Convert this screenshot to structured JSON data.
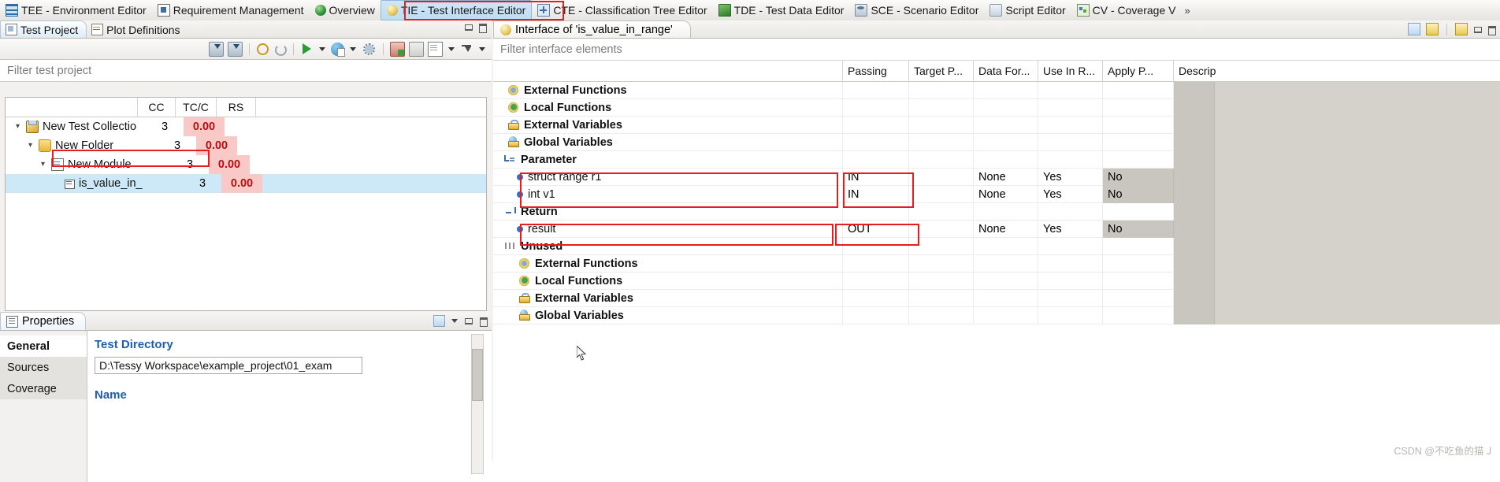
{
  "perspectives": [
    {
      "label": "TEE - Environment Editor",
      "icon": "grid-icon",
      "active": false
    },
    {
      "label": "Requirement Management",
      "icon": "document-icon",
      "active": false
    },
    {
      "label": "Overview",
      "icon": "globe-icon",
      "active": false
    },
    {
      "label": "TIE - Test Interface Editor",
      "icon": "tie-icon",
      "active": true
    },
    {
      "label": "CTE - Classification Tree Editor",
      "icon": "cte-icon",
      "active": false
    },
    {
      "label": "TDE - Test Data Editor",
      "icon": "tde-icon",
      "active": false
    },
    {
      "label": "SCE - Scenario Editor",
      "icon": "sce-icon",
      "active": false
    },
    {
      "label": "Script Editor",
      "icon": "script-icon",
      "active": false
    },
    {
      "label": "CV - Coverage V",
      "icon": "coverage-icon",
      "active": false
    }
  ],
  "topbar_overflow": "»",
  "left": {
    "tabs": [
      {
        "label": "Test Project",
        "icon": "test-project-icon",
        "selected": true
      },
      {
        "label": "Plot Definitions",
        "icon": "plot-definitions-icon",
        "selected": false
      }
    ],
    "filter_placeholder": "Filter test project",
    "toolbar_icons": [
      "import-icon",
      "export-icon",
      "separator",
      "find-icon",
      "refresh-icon",
      "separator",
      "run-icon",
      "run-dropdown-caret",
      "run-report-icon",
      "report-dropdown-caret",
      "settings-icon",
      "separator",
      "new-test-icon",
      "copy-icon",
      "paste-icon",
      "page-dropdown-caret",
      "filter-icon",
      "filter-dropdown-caret"
    ],
    "columns": [
      "",
      "CC",
      "TC/C",
      "RS"
    ],
    "rows": [
      {
        "name": "New Test Collectio",
        "icon": "collection-icon",
        "indent": 0,
        "expanded": true,
        "cc": "3",
        "tcc": "0.00",
        "selected": false
      },
      {
        "name": "New Folder",
        "icon": "folder-icon",
        "indent": 1,
        "expanded": true,
        "cc": "3",
        "tcc": "0.00",
        "selected": false
      },
      {
        "name": "New Module",
        "icon": "module-icon",
        "indent": 2,
        "expanded": true,
        "cc": "3",
        "tcc": "0.00",
        "selected": false
      },
      {
        "name": "is_value_in_",
        "icon": "function-icon",
        "indent": 3,
        "expanded": false,
        "cc": "3",
        "tcc": "0.00",
        "selected": true
      }
    ]
  },
  "properties": {
    "tab_label": "Properties",
    "nav": [
      "General",
      "Sources",
      "Coverage"
    ],
    "test_directory_label": "Test Directory",
    "test_directory_value": "D:\\Tessy Workspace\\example_project\\01_exam",
    "name_label": "Name"
  },
  "editor": {
    "tab_label": "Interface of 'is_value_in_range'",
    "tab_icon": "tie-icon",
    "filter_placeholder": "Filter interface elements",
    "columns": [
      "",
      "Passing",
      "Target P...",
      "Data For...",
      "Use In R...",
      "Apply P...",
      "Descrip"
    ],
    "rows": [
      {
        "name": "External Functions",
        "icon": "external-functions-icon",
        "indent": 1,
        "type": "group",
        "passing": "",
        "target": "",
        "dataformat": "",
        "useinr": "",
        "applyp": ""
      },
      {
        "name": "Local Functions",
        "icon": "local-functions-icon",
        "indent": 1,
        "type": "group",
        "passing": "",
        "target": "",
        "dataformat": "",
        "useinr": "",
        "applyp": ""
      },
      {
        "name": "External Variables",
        "icon": "external-variables-icon",
        "indent": 1,
        "type": "group",
        "passing": "",
        "target": "",
        "dataformat": "",
        "useinr": "",
        "applyp": ""
      },
      {
        "name": "Global Variables",
        "icon": "global-variables-icon",
        "indent": 1,
        "type": "group",
        "passing": "",
        "target": "",
        "dataformat": "",
        "useinr": "",
        "applyp": ""
      },
      {
        "name": "Parameter",
        "icon": "parameter-icon",
        "indent": 1,
        "type": "group",
        "passing": "",
        "target": "",
        "dataformat": "",
        "useinr": "",
        "applyp": ""
      },
      {
        "name": "struct range r1",
        "icon": "bullet-icon",
        "indent": 2,
        "type": "leaf",
        "passing": "IN",
        "target": "",
        "dataformat": "None",
        "useinr": "Yes",
        "applyp": "No"
      },
      {
        "name": "int v1",
        "icon": "bullet-icon",
        "indent": 2,
        "type": "leaf",
        "passing": "IN",
        "target": "",
        "dataformat": "None",
        "useinr": "Yes",
        "applyp": "No"
      },
      {
        "name": "Return",
        "icon": "return-icon",
        "indent": 1,
        "type": "group",
        "passing": "",
        "target": "",
        "dataformat": "",
        "useinr": "",
        "applyp": ""
      },
      {
        "name": "result",
        "icon": "bullet-icon",
        "indent": 2,
        "type": "leaf",
        "passing": "OUT",
        "target": "",
        "dataformat": "None",
        "useinr": "Yes",
        "applyp": "No"
      },
      {
        "name": "Unused",
        "icon": "unused-icon",
        "indent": 1,
        "type": "group",
        "passing": "",
        "target": "",
        "dataformat": "",
        "useinr": "",
        "applyp": ""
      },
      {
        "name": "External Functions",
        "icon": "external-functions-icon",
        "indent": 2,
        "type": "group",
        "passing": "",
        "target": "",
        "dataformat": "",
        "useinr": "",
        "applyp": ""
      },
      {
        "name": "Local Functions",
        "icon": "local-functions-icon",
        "indent": 2,
        "type": "group",
        "passing": "",
        "target": "",
        "dataformat": "",
        "useinr": "",
        "applyp": ""
      },
      {
        "name": "External Variables",
        "icon": "external-variables-icon",
        "indent": 2,
        "type": "group",
        "passing": "",
        "target": "",
        "dataformat": "",
        "useinr": "",
        "applyp": ""
      },
      {
        "name": "Global Variables",
        "icon": "global-variables-icon",
        "indent": 2,
        "type": "group",
        "passing": "",
        "target": "",
        "dataformat": "",
        "useinr": "",
        "applyp": ""
      }
    ]
  },
  "watermark": "CSDN @不吃鱼的猫Ｊ",
  "colors": {
    "accent_highlight": "#cde8f7",
    "annotation_red": "#e71d1d",
    "coverage_red_bg": "#f9c9c7",
    "coverage_red_text": "#b01010",
    "link_blue": "#1d5fa8"
  }
}
